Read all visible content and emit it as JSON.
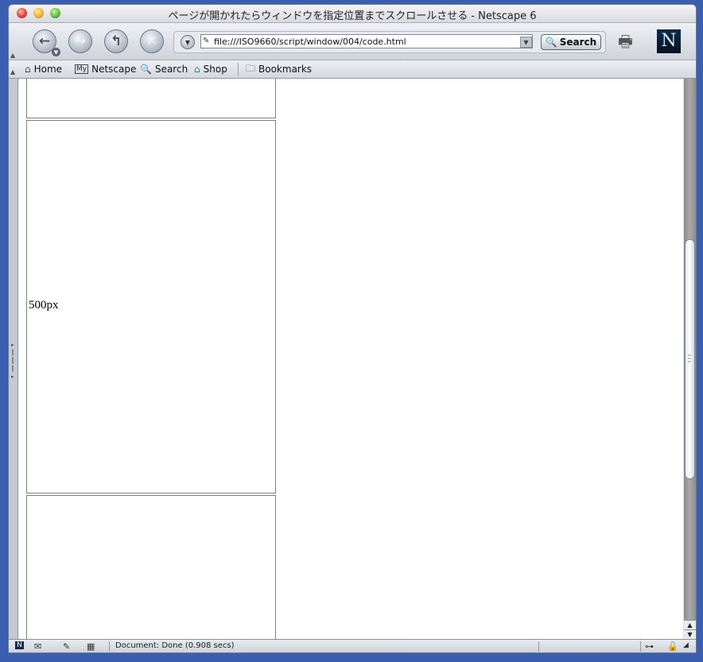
{
  "window": {
    "title": "ページが開かれたらウィンドウを指定位置までスクロールさせる - Netscape 6"
  },
  "toolbar": {
    "back_icon": "back-arrow-icon",
    "forward_icon": "forward-arrow-icon",
    "reload_icon": "reload-icon",
    "stop_icon": "stop-icon",
    "url": "file:///ISO9660/script/window/004/code.html",
    "search_label": "Search",
    "logo_letter": "N"
  },
  "personal_toolbar": {
    "items": [
      {
        "label": "Home",
        "icon": "home-icon"
      },
      {
        "label": "Netscape",
        "icon": "my-netscape-icon",
        "badge": "My"
      },
      {
        "label": "Search",
        "icon": "search-icon"
      },
      {
        "label": "Shop",
        "icon": "shop-icon"
      },
      {
        "label": "Bookmarks",
        "icon": "folder-icon"
      }
    ]
  },
  "content": {
    "cells": [
      {
        "label": ""
      },
      {
        "label": "500px"
      },
      {
        "label": ""
      }
    ]
  },
  "statusbar": {
    "text": "Document: Done (0.908 secs)"
  }
}
